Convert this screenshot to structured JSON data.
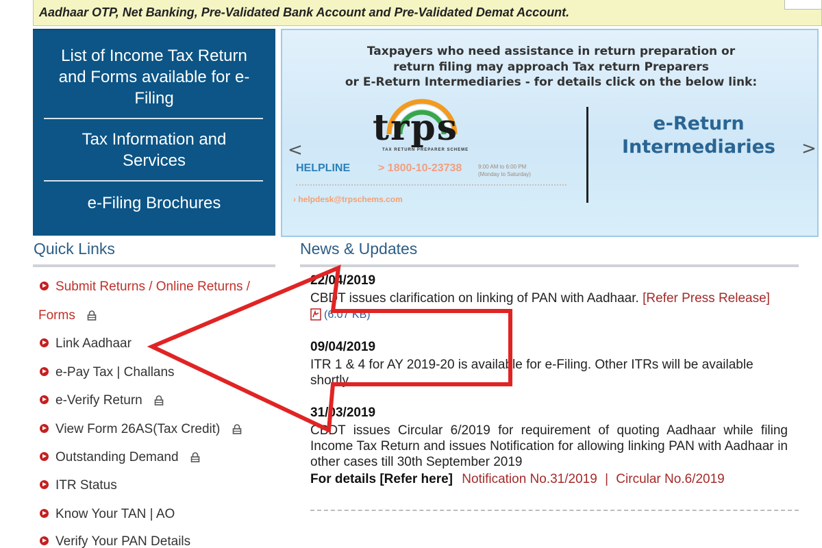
{
  "top_notice": {
    "text": "Aadhaar OTP, Net Banking, Pre-Validated Bank Account and Pre-Validated Demat Account."
  },
  "left_panel": {
    "items": [
      {
        "line1": "List of Income Tax Return",
        "line2": "and Forms available for e-",
        "line3": "Filing"
      },
      {
        "line1": "Tax Information and",
        "line2": "Services"
      },
      {
        "line1": "e-Filing Brochures"
      }
    ]
  },
  "banner": {
    "line1": "Taxpayers who need assistance in return preparation or",
    "line2": "return filing may approach Tax return Preparers",
    "line3": "or E-Return Intermediaries - for details click on the below link:",
    "logo_text": "trps",
    "logo_sub": "TAX RETURN   PREPARER SCHEME",
    "helpline_label": "HELPLINE",
    "helpline_number": "> 1800-10-23738",
    "helpline_hours_1": "9:00 AM to 6:00 PM",
    "helpline_hours_2": "(Monday to Saturday)",
    "email": "› helpdesk@trpschems.com",
    "eri_line1": "e-Return",
    "eri_line2": "Intermediaries",
    "prev_arrow": "<",
    "next_arrow": ">"
  },
  "quick_links": {
    "title": "Quick Links",
    "items": [
      {
        "label": "Submit Returns / Online Returns /",
        "continuation": "Forms",
        "locked": true,
        "highlight": true
      },
      {
        "label": "Link Aadhaar",
        "locked": false
      },
      {
        "label": "e-Pay Tax | Challans",
        "locked": false
      },
      {
        "label": "e-Verify Return",
        "locked": true
      },
      {
        "label": "View Form 26AS(Tax Credit)",
        "locked": true
      },
      {
        "label": "Outstanding Demand",
        "locked": true
      },
      {
        "label": "ITR Status",
        "locked": false
      },
      {
        "label": "Know Your TAN | AO",
        "locked": false
      },
      {
        "label": "Verify Your PAN Details",
        "locked": false
      }
    ]
  },
  "news": {
    "title": "News & Updates",
    "items": [
      {
        "date": "22/04/2019",
        "text": "CBDT issues clarification on linking of PAN with Aadhaar.",
        "link": "[Refer Press Release]",
        "file_size": "(6.07 KB)"
      },
      {
        "date": "09/04/2019",
        "text": "ITR 1 & 4 for AY 2019-20 is available for e-Filing. Other ITRs will be available shortly."
      },
      {
        "date": "31/03/2019",
        "text": "CBDT issues Circular 6/2019 for requirement of quoting Aadhaar while filing Income Tax Return and issues Notification for allowing linking PAN with Aadhaar in other cases till 30th September 2019",
        "details_label": "For details [Refer here]",
        "link1": "Notification No.31/2019",
        "separator": "|",
        "link2": "Circular No.6/2019"
      }
    ]
  },
  "colors": {
    "panel_blue": "#0c5586",
    "section_title": "#2c5d86",
    "link_red": "#a52a2a",
    "bullet_red": "#c42020",
    "annotation_arrow": "#e02424"
  },
  "icons": {
    "lock": "lock-icon",
    "bullet": "bullet-icon",
    "pdf": "pdf-icon",
    "annotation": "annotation-arrow"
  }
}
